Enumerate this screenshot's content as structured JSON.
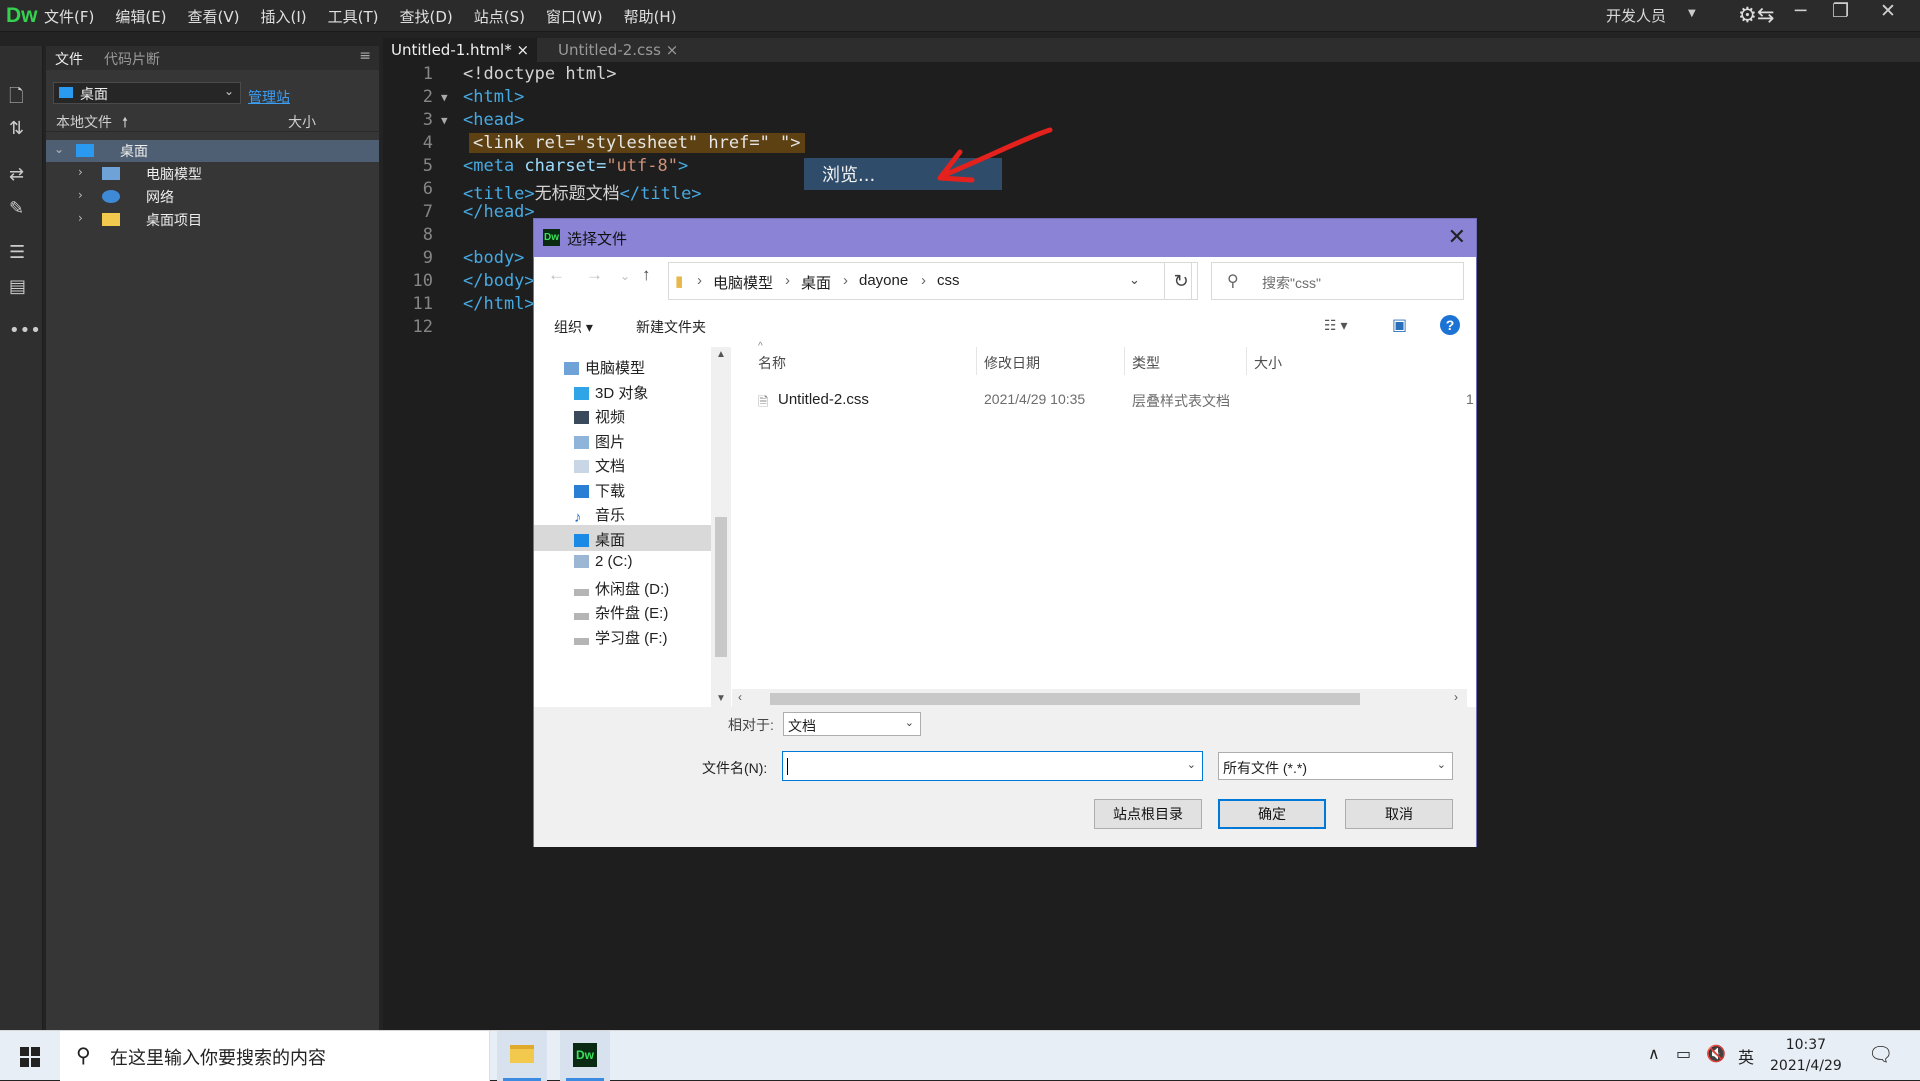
{
  "app": {
    "logo": "Dw",
    "menus": [
      "文件(F)",
      "编辑(E)",
      "查看(V)",
      "插入(I)",
      "工具(T)",
      "查找(D)",
      "站点(S)",
      "窗口(W)",
      "帮助(H)"
    ],
    "workspace": "开发人员",
    "accent_color": "#35d04f"
  },
  "files_panel": {
    "tabs": [
      "文件",
      "代码片断"
    ],
    "location": "桌面",
    "manage_sites": "管理站",
    "col_local": "本地文件",
    "col_size": "大小",
    "tree": [
      {
        "label": "桌面",
        "level": 0,
        "icon": "desktop-icon",
        "selected": true
      },
      {
        "label": "电脑模型",
        "level": 1,
        "icon": "computer-icon"
      },
      {
        "label": "网络",
        "level": 1,
        "icon": "network-icon"
      },
      {
        "label": "桌面项目",
        "level": 1,
        "icon": "folder-icon"
      }
    ]
  },
  "editor": {
    "tabs": [
      "Untitled-1.html*",
      "Untitled-2.css"
    ],
    "line_numbers": [
      "1",
      "2",
      "3",
      "4",
      "5",
      "6",
      "7",
      "8",
      "9",
      "10",
      "11",
      "12"
    ],
    "lines": {
      "l1": "<!doctype html>",
      "l2": "<html>",
      "l3": "<head>",
      "l4": "<link rel=\"stylesheet\" href=\" \">",
      "l5_tag": "<meta ",
      "l5_attr": "charset=",
      "l5_str": "\"utf-8\"",
      "l5_end": ">",
      "l6_open": "<title>",
      "l6_text": "无标题文档",
      "l6_close": "</title>",
      "l7": "</head>",
      "l9": "<body>",
      "l10": "</body>",
      "l11": "</html>"
    },
    "hint_popup": "浏览..."
  },
  "dialog": {
    "title": "选择文件",
    "breadcrumb": [
      "电脑模型",
      "桌面",
      "dayone",
      "css"
    ],
    "search_placeholder": "搜索\"css\"",
    "organize": "组织",
    "new_folder": "新建文件夹",
    "nav_items": [
      "电脑模型",
      "3D 对象",
      "视频",
      "图片",
      "文档",
      "下载",
      "音乐",
      "桌面",
      "2 (C:)",
      "休闲盘 (D:)",
      "杂件盘 (E:)",
      "学习盘 (F:)"
    ],
    "nav_selected": "桌面",
    "columns": [
      "名称",
      "修改日期",
      "类型",
      "大小"
    ],
    "files": [
      {
        "name": "Untitled-2.css",
        "date": "2021/4/29 10:35",
        "type": "层叠样式表文档",
        "size": "1"
      }
    ],
    "relative_label": "相对于:",
    "relative_value": "文档",
    "filename_label": "文件名(N):",
    "filename_value": "",
    "filetype_value": "所有文件 (*.*)",
    "btn_site_root": "站点根目录",
    "btn_ok": "确定",
    "btn_cancel": "取消"
  },
  "taskbar": {
    "search_placeholder": "在这里输入你要搜索的内容",
    "ime": "英",
    "time": "10:37",
    "date": "2021/4/29"
  }
}
